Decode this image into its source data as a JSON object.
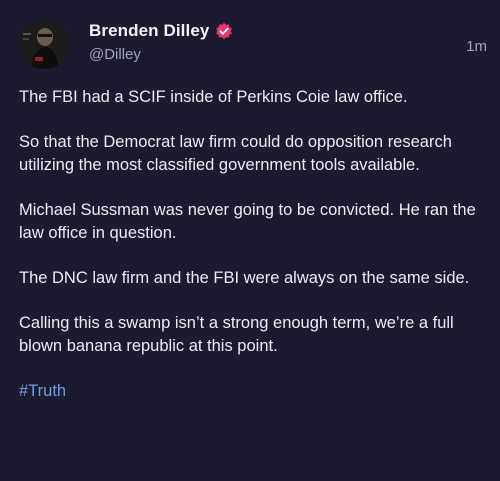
{
  "post": {
    "author": {
      "display_name": "Brenden Dilley",
      "handle": "@Dilley",
      "verified": true
    },
    "timestamp": "1m",
    "paragraphs": [
      "The FBI had a SCIF inside of Perkins Coie law office.",
      "So that the Democrat law firm could do opposition research utilizing the most classified government tools available.",
      "Michael Sussman was never going to be convicted. He ran the law office in question.",
      "The DNC law firm and the FBI were always on the same side.",
      "Calling this a swamp isn’t a strong enough term, we’re a full blown banana republic at this point."
    ],
    "hashtag": "#Truth"
  },
  "colors": {
    "background": "#1b1a2f",
    "text": "#ececf1",
    "muted": "#a3a3b5",
    "hashtag": "#6f9de8",
    "verified_badge": "#e8346f"
  },
  "icons": {
    "verified": "verified-badge-icon",
    "avatar": "profile-avatar"
  }
}
